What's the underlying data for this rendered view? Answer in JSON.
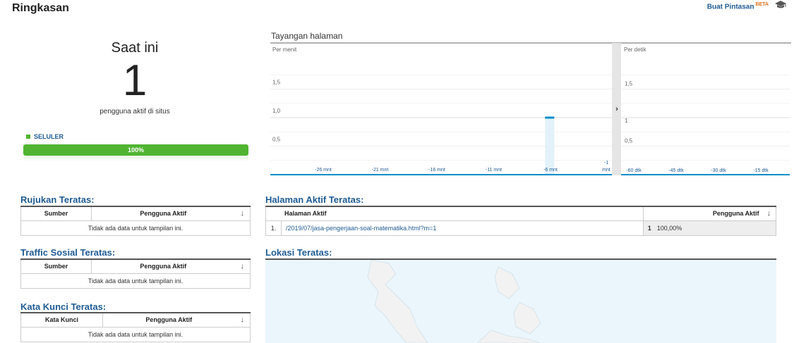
{
  "header": {
    "title": "Ringkasan",
    "shortcut_label": "Buat Pintasan",
    "shortcut_badge": "BETA"
  },
  "realtime": {
    "title": "Saat ini",
    "count": "1",
    "subtitle": "pengguna aktif di situs",
    "device_label": "SELULER",
    "device_percent": "100%",
    "device_fraction": 1.0,
    "device_color": "#50b432"
  },
  "chart": {
    "title": "Tayangan halaman",
    "left_label": "Per menit",
    "right_label": "Per detik",
    "toggle_glyph": "›"
  },
  "chart_data": [
    {
      "type": "bar",
      "title": "Per menit",
      "y_ticks": [
        "1,5",
        "1,0",
        "0,5"
      ],
      "ylim": [
        0,
        2
      ],
      "x_ticks": [
        "-26 mnt",
        "-21 mnt",
        "-16 mnt",
        "-11 mnt",
        "-6 mnt",
        "-1 mnt"
      ],
      "x": [
        -29,
        -28,
        -27,
        -26,
        -25,
        -24,
        -23,
        -22,
        -21,
        -20,
        -19,
        -18,
        -17,
        -16,
        -15,
        -14,
        -13,
        -12,
        -11,
        -10,
        -9,
        -8,
        -7,
        -6,
        -5,
        -4,
        -3,
        -2,
        -1,
        0
      ],
      "values": [
        0,
        0,
        0,
        0,
        0,
        0,
        0,
        0,
        0,
        0,
        0,
        0,
        0,
        0,
        0,
        0,
        0,
        0,
        0,
        0,
        0,
        0,
        0,
        0,
        1,
        0,
        0,
        0,
        0,
        0
      ],
      "color": "#058dc7"
    },
    {
      "type": "bar",
      "title": "Per detik",
      "y_ticks": [
        "1,5",
        "1",
        "0,5"
      ],
      "ylim": [
        0,
        2
      ],
      "x_ticks": [
        "-60 dtk",
        "-45 dtk",
        "-30 dtk",
        "-15 dtk"
      ],
      "values": [],
      "color": "#058dc7"
    }
  ],
  "referrals": {
    "title": "Rujukan Teratas:",
    "col1": "Sumber",
    "col2": "Pengguna Aktif",
    "empty": "Tidak ada data untuk tampilan ini."
  },
  "social": {
    "title": "Traffic Sosial Teratas:",
    "col1": "Sumber",
    "col2": "Pengguna Aktif",
    "empty": "Tidak ada data untuk tampilan ini."
  },
  "keywords": {
    "title": "Kata Kunci Teratas:",
    "col1": "Kata Kunci",
    "col2": "Pengguna Aktif",
    "empty": "Tidak ada data untuk tampilan ini."
  },
  "active_pages": {
    "title": "Halaman Aktif Teratas:",
    "col1": "Halaman Aktif",
    "col2": "Pengguna Aktif",
    "rows": [
      {
        "index": "1.",
        "url": "/2019/07/jasa-pengerjaan-soal-matematika.html?m=1",
        "count": "1",
        "percent": "100,00%"
      }
    ]
  },
  "locations": {
    "title": "Lokasi Teratas:"
  },
  "icons": {
    "sort": "sort-down-arrow-icon",
    "shortcut": "graduation-cap-icon"
  }
}
